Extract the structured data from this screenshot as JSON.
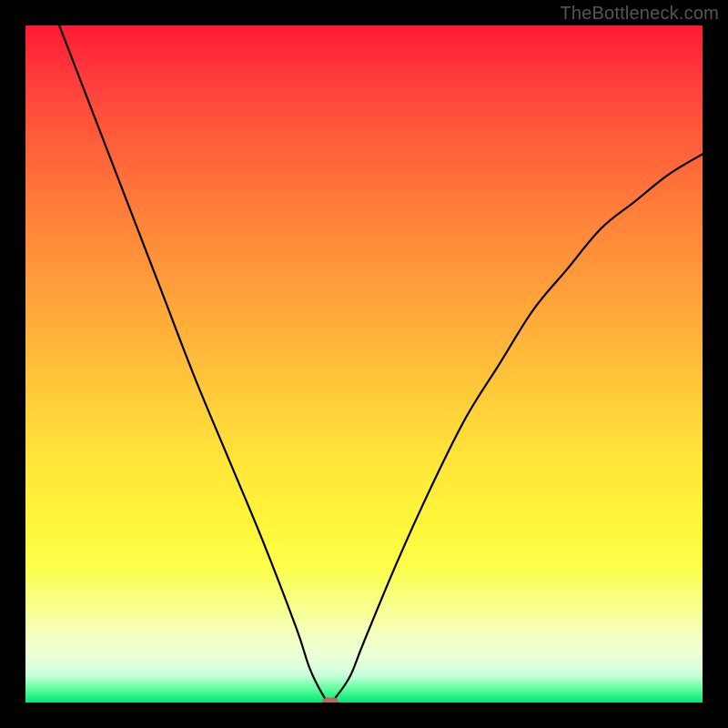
{
  "watermark": "TheBottleneck.com",
  "chart_data": {
    "type": "line",
    "title": "",
    "xlabel": "",
    "ylabel": "",
    "xlim": [
      0,
      100
    ],
    "ylim": [
      0,
      100
    ],
    "grid": false,
    "legend": false,
    "background_gradient": {
      "stops": [
        {
          "pos": 0,
          "color": "#ff1a33"
        },
        {
          "pos": 27,
          "color": "#ff7d3a"
        },
        {
          "pos": 57,
          "color": "#ffd23a"
        },
        {
          "pos": 80,
          "color": "#fdff4a"
        },
        {
          "pos": 96,
          "color": "#c7ffdb"
        },
        {
          "pos": 100,
          "color": "#00e676"
        }
      ]
    },
    "series": [
      {
        "name": "bottleneck-curve",
        "x": [
          5,
          10,
          15,
          20,
          25,
          30,
          35,
          40,
          42,
          44,
          45,
          46,
          48,
          50,
          55,
          60,
          65,
          70,
          75,
          80,
          85,
          90,
          95,
          100
        ],
        "y": [
          100,
          87,
          74,
          61,
          48,
          36,
          24,
          11,
          5,
          1,
          0,
          1,
          4,
          9,
          21,
          32,
          42,
          50,
          58,
          64,
          70,
          74,
          78,
          81
        ]
      }
    ],
    "marker": {
      "x": 45,
      "y": 0,
      "color": "#b96a5e"
    }
  }
}
